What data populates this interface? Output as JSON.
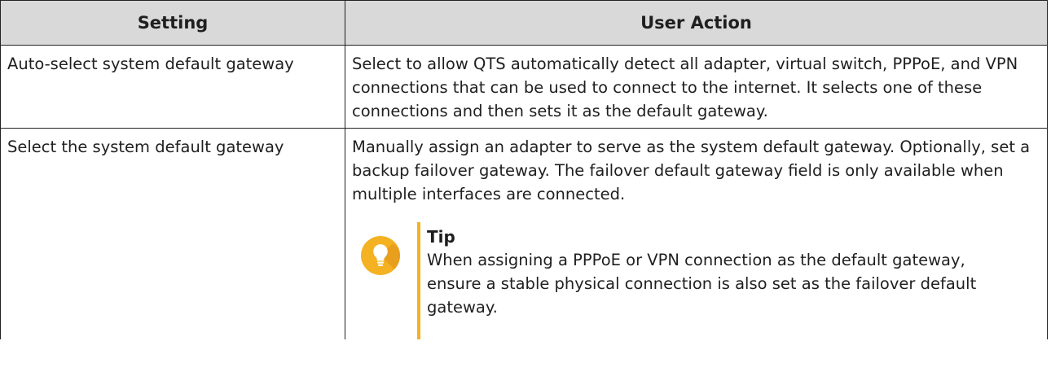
{
  "table": {
    "headers": [
      "Setting",
      "User Action"
    ],
    "rows": [
      {
        "setting": "Auto-select system default gateway",
        "action": "Select to allow QTS automatically detect all adapter, virtual switch, PPPoE, and VPN connections that can be used to connect to the internet. It selects one of these connections and then sets it as the default gateway."
      },
      {
        "setting": "Select the system default gateway",
        "action": "Manually assign an adapter to serve as the system default gateway. Optionally, set a backup failover gateway. The failover default gateway field is only available when multiple interfaces are connected.",
        "tip": {
          "icon": "lightbulb-icon",
          "title": "Tip",
          "text": "When assigning a PPPoE or VPN connection as the default gateway, ensure a stable physical connection is also set as the failover default gateway."
        }
      }
    ]
  },
  "colors": {
    "header_bg": "#d9d9d9",
    "tip_accent": "#f4b223",
    "border": "#222222"
  }
}
